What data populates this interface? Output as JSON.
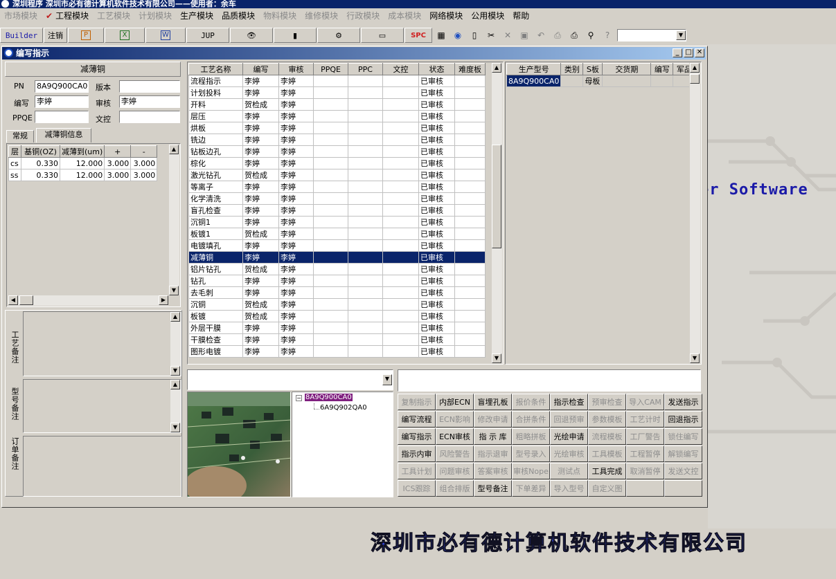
{
  "app_title": "深圳程序    深圳市必有德计算机软件技术有限公司——使用者：余车",
  "menus": [
    {
      "label": "市场模块",
      "enabled": false
    },
    {
      "label": "工程模块",
      "enabled": true,
      "checked": true
    },
    {
      "label": "工艺模块",
      "enabled": false
    },
    {
      "label": "计划模块",
      "enabled": false
    },
    {
      "label": "生产模块",
      "enabled": true
    },
    {
      "label": "品质模块",
      "enabled": true
    },
    {
      "label": "物料模块",
      "enabled": false
    },
    {
      "label": "维修模块",
      "enabled": false
    },
    {
      "label": "行政模块",
      "enabled": false
    },
    {
      "label": "成本模块",
      "enabled": false
    },
    {
      "label": "网络模块",
      "enabled": true
    },
    {
      "label": "公用模块",
      "enabled": true
    },
    {
      "label": "帮助",
      "enabled": true
    }
  ],
  "toolbar": {
    "builder": "Builder",
    "logout": "注销",
    "jup": "JUP",
    "spc": "SPC"
  },
  "window_title": "编写指示",
  "left": {
    "header": "减薄铜",
    "pn_label": "PN",
    "pn_value": "8A9Q900CA0",
    "version_label": "版本",
    "version_value": "",
    "writer_label": "编写",
    "writer_value": "李婷",
    "review_label": "审核",
    "review_value": "李婷",
    "ppqe_label": "PPQE",
    "ppqe_value": "",
    "doc_label": "文控",
    "doc_value": "",
    "tabs": [
      "常规",
      "减薄铜信息"
    ],
    "copper_cols": [
      "层",
      "基铜(OZ)",
      "减薄到(um)",
      "+",
      "-"
    ],
    "copper_rows": [
      [
        "cs",
        "0.330",
        "12.000",
        "3.000",
        "3.000"
      ],
      [
        "ss",
        "0.330",
        "12.000",
        "3.000",
        "3.000"
      ]
    ],
    "note1_label": "工艺备注",
    "note2_label": "型号备注",
    "note3_label": "订单备注"
  },
  "process": {
    "cols": [
      "工艺名称",
      "编写",
      "审核",
      "PPQE",
      "PPC",
      "文控",
      "状态",
      "难度板"
    ],
    "rows": [
      [
        "流程指示",
        "李婷",
        "李婷",
        "已审核"
      ],
      [
        "计划投料",
        "李婷",
        "李婷",
        "已审核"
      ],
      [
        "开料",
        "贺检成",
        "李婷",
        "已审核"
      ],
      [
        "层压",
        "李婷",
        "李婷",
        "已审核"
      ],
      [
        "烘板",
        "李婷",
        "李婷",
        "已审核"
      ],
      [
        "铣边",
        "李婷",
        "李婷",
        "已审核"
      ],
      [
        "钻板边孔",
        "李婷",
        "李婷",
        "已审核"
      ],
      [
        "棕化",
        "李婷",
        "李婷",
        "已审核"
      ],
      [
        "激光钻孔",
        "贺检成",
        "李婷",
        "已审核"
      ],
      [
        "等离子",
        "李婷",
        "李婷",
        "已审核"
      ],
      [
        "化学清洗",
        "李婷",
        "李婷",
        "已审核"
      ],
      [
        "盲孔检查",
        "李婷",
        "李婷",
        "已审核"
      ],
      [
        "沉铜1",
        "李婷",
        "李婷",
        "已审核"
      ],
      [
        "板镀1",
        "贺检成",
        "李婷",
        "已审核"
      ],
      [
        "电镀填孔",
        "李婷",
        "李婷",
        "已审核"
      ],
      [
        "减薄铜",
        "李婷",
        "李婷",
        "已审核"
      ],
      [
        "铝片钻孔",
        "贺检成",
        "李婷",
        "已审核"
      ],
      [
        "钻孔",
        "李婷",
        "李婷",
        "已审核"
      ],
      [
        "去毛刺",
        "李婷",
        "李婷",
        "已审核"
      ],
      [
        "沉铜",
        "贺检成",
        "李婷",
        "已审核"
      ],
      [
        "板镀",
        "贺检成",
        "李婷",
        "已审核"
      ],
      [
        "外层干膜",
        "李婷",
        "李婷",
        "已审核"
      ],
      [
        "干膜检查",
        "李婷",
        "李婷",
        "已审核"
      ],
      [
        "图形电镀",
        "李婷",
        "李婷",
        "已审核"
      ]
    ],
    "selected_index": 15
  },
  "models": {
    "cols": [
      "生产型号",
      "类别",
      "S板",
      "交货期",
      "编写",
      "军品"
    ],
    "rows": [
      [
        "8A9Q900CA0",
        "",
        "母板",
        "",
        "",
        ""
      ]
    ]
  },
  "tree": {
    "root": "8A9Q900CA0",
    "child": "6A9Q902QA0"
  },
  "actions": [
    [
      {
        "l": "复制指示",
        "e": false
      },
      {
        "l": "内部ECN",
        "e": true
      },
      {
        "l": "盲埋孔板",
        "e": true
      },
      {
        "l": "报价条件",
        "e": false
      },
      {
        "l": "指示检查",
        "e": true
      },
      {
        "l": "预审检查",
        "e": false
      },
      {
        "l": "导入CAM",
        "e": false
      },
      {
        "l": "发送指示",
        "e": true
      }
    ],
    [
      {
        "l": "编写流程",
        "e": true
      },
      {
        "l": "ECN影响",
        "e": false
      },
      {
        "l": "修改申请",
        "e": false
      },
      {
        "l": "合拼条件",
        "e": false
      },
      {
        "l": "回退预审",
        "e": false
      },
      {
        "l": "参数模板",
        "e": false
      },
      {
        "l": "工艺计时",
        "e": false
      },
      {
        "l": "回退指示",
        "e": true
      }
    ],
    [
      {
        "l": "编写指示",
        "e": true
      },
      {
        "l": "ECN审核",
        "e": true
      },
      {
        "l": "指 示 库",
        "e": true
      },
      {
        "l": "粗略拼板",
        "e": false
      },
      {
        "l": "光绘申请",
        "e": true
      },
      {
        "l": "流程模板",
        "e": false
      },
      {
        "l": "工厂警告",
        "e": false
      },
      {
        "l": "锁住编写",
        "e": false
      }
    ],
    [
      {
        "l": "指示内审",
        "e": true
      },
      {
        "l": "风险警告",
        "e": false
      },
      {
        "l": "指示退审",
        "e": false
      },
      {
        "l": "型号录入",
        "e": false
      },
      {
        "l": "光绘审核",
        "e": false
      },
      {
        "l": "工具模板",
        "e": false
      },
      {
        "l": "工程暂停",
        "e": false
      },
      {
        "l": "解锁编写",
        "e": false
      }
    ],
    [
      {
        "l": "工具计划",
        "e": false
      },
      {
        "l": "问题审核",
        "e": false
      },
      {
        "l": "答案审核",
        "e": false
      },
      {
        "l": "审核Nope",
        "e": false
      },
      {
        "l": "测试点",
        "e": false
      },
      {
        "l": "工具完成",
        "e": true
      },
      {
        "l": "取消暂停",
        "e": false
      },
      {
        "l": "发送文控",
        "e": false
      }
    ],
    [
      {
        "l": "ICS跟踪",
        "e": false
      },
      {
        "l": "组合排版",
        "e": false
      },
      {
        "l": "型号备注",
        "e": true
      },
      {
        "l": "下单差异",
        "e": false
      },
      {
        "l": "导入型号",
        "e": false
      },
      {
        "l": "自定义图",
        "e": false
      },
      {
        "l": "",
        "e": false
      },
      {
        "l": "",
        "e": false
      }
    ]
  ],
  "brand_text_1": "er Software",
  "brand_text_2": "深圳市必有德计算机软件技术有限公司"
}
